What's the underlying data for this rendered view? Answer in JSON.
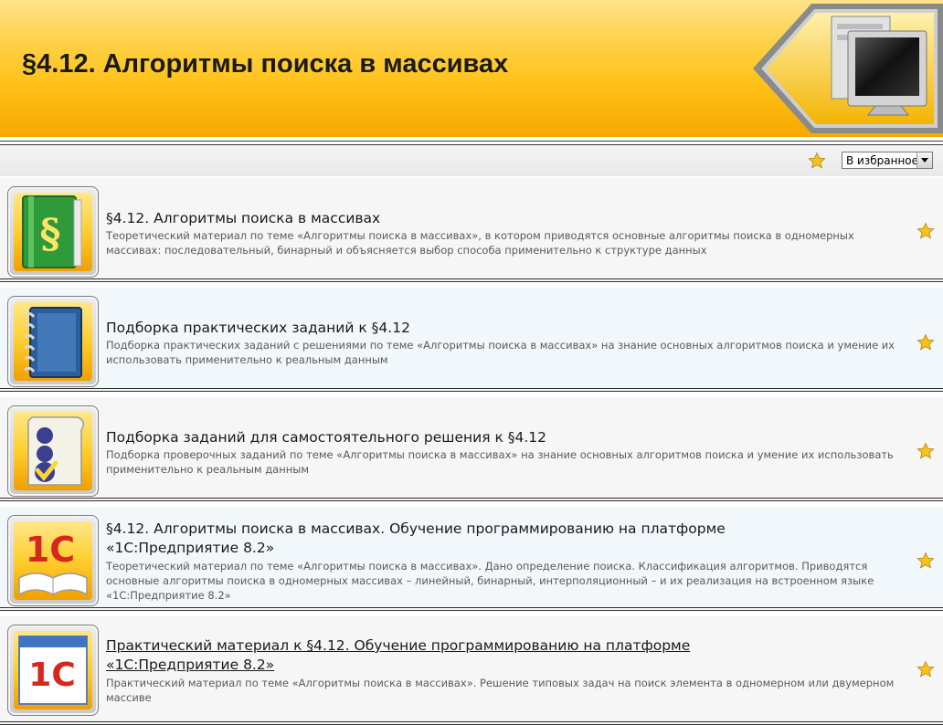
{
  "header": {
    "title": "§4.12. Алгоритмы поиска в массивах",
    "gradient_top": "#ffe38a",
    "gradient_bottom": "#f5a800"
  },
  "toolbar": {
    "favorite_select": {
      "selected": "В избранное"
    }
  },
  "colors": {
    "star": "#f7c21d",
    "row_alt": "#f1f7fb",
    "row": "#f6f6f6",
    "desc_text": "#5a5a5a"
  },
  "items": [
    {
      "title": "§4.12. Алгоритмы поиска в массивах",
      "description": "Теоретический материал по теме «Алгоритмы поиска в массивах», в котором приводятся основные алгоритмы поиска в одномерных массивах: последовательный, бинарный и объясняется выбор способа применительно к структуре данных",
      "icon": "paragraph-book-icon"
    },
    {
      "title": "Подборка практических заданий к §4.12",
      "description": "Подборка практических заданий с решениями по теме «Алгоритмы поиска в массивах» на знание основных алгоритмов поиска и умение их использовать применительно к реальным данным",
      "icon": "notebook-icon"
    },
    {
      "title": "Подборка заданий для самостоятельного решения к §4.12",
      "description": "Подборка проверочных заданий по теме «Алгоритмы поиска в массивах» на знание основных алгоритмов поиска и умение их использовать применительно к реальным данным",
      "icon": "test-checkmark-icon"
    },
    {
      "title_line1": "§4.12. Алгоритмы поиска в массивах. Обучение программированию на платформе",
      "title_line2": "«1С:Предприятие 8.2»",
      "description": "Теоретический материал по теме «Алгоритмы поиска в массивах». Дано определение поиска. Классификация алгоритмов. Приводятся основные алгоритмы поиска в одномерных массивах – линейный, бинарный, интерполяционный – и их реализация на встроенном языке «1С:Предприятие 8.2»",
      "icon": "1c-book-icon",
      "logo_text": "1С"
    },
    {
      "title_line1": "Практический материал к §4.12. Обучение программированию на платформе",
      "title_line2": "«1С:Предприятие 8.2»",
      "description": "Практический материал по теме «Алгоритмы поиска в массивах». Решение типовых задач на поиск элемента в одномерном или двумерном массиве",
      "icon": "1c-window-icon",
      "logo_text": "1С"
    }
  ]
}
